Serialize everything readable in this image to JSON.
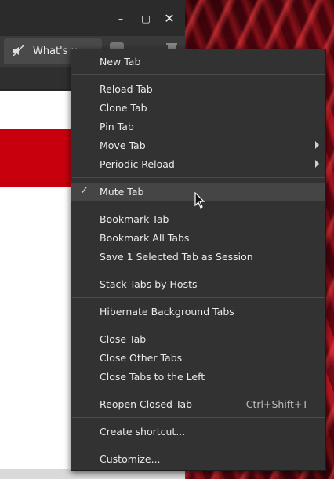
{
  "window": {
    "tab_title": "What's u",
    "controls": {
      "minimize": "–",
      "maximize": "▢",
      "close": "✕"
    }
  },
  "menu": {
    "items": [
      {
        "label": "New Tab"
      },
      {
        "label": "Reload Tab"
      },
      {
        "label": "Clone Tab"
      },
      {
        "label": "Pin Tab"
      },
      {
        "label": "Move Tab",
        "submenu": true
      },
      {
        "label": "Periodic Reload",
        "submenu": true
      },
      {
        "label": "Mute Tab",
        "checked": true,
        "highlighted": true
      },
      {
        "label": "Bookmark Tab"
      },
      {
        "label": "Bookmark All Tabs"
      },
      {
        "label": "Save 1 Selected Tab as Session"
      },
      {
        "label": "Stack Tabs by Hosts"
      },
      {
        "label": "Hibernate Background Tabs"
      },
      {
        "label": "Close Tab"
      },
      {
        "label": "Close Other Tabs"
      },
      {
        "label": "Close Tabs to the Left"
      },
      {
        "label": "Reopen Closed Tab",
        "shortcut": "Ctrl+Shift+T"
      },
      {
        "label": "Create shortcut..."
      },
      {
        "label": "Customize..."
      }
    ],
    "check_glyph": "✓"
  },
  "colors": {
    "menu_bg": "#323232",
    "highlight": "#454545",
    "accent_red": "#c8000e"
  },
  "icons": {
    "tab": "mute-speaker-icon",
    "new_tab": "add-tab-icon",
    "trash": "trash-icon",
    "cursor": "mouse-pointer-icon"
  }
}
